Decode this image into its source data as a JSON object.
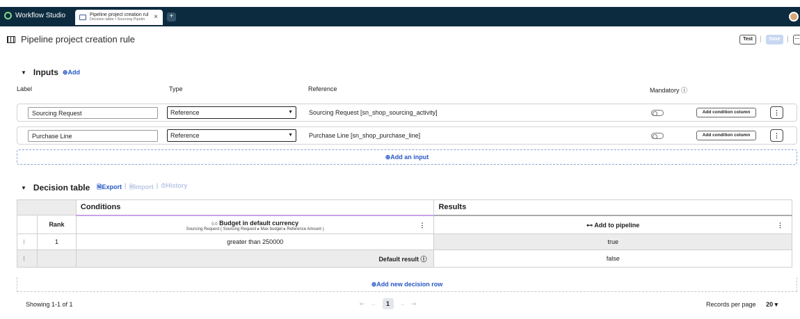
{
  "app": {
    "brand": "Workflow Studio"
  },
  "tab": {
    "title": "Pipeline project creation rul",
    "subtitle": "Decision table • Sourcing Pipelin",
    "close": "×",
    "add": "+"
  },
  "header": {
    "title": "Pipeline project creation rule",
    "test": "Test",
    "save": "Save",
    "more": "···",
    "sep": "|"
  },
  "inputs": {
    "title": "Inputs",
    "add": "⊕Add",
    "columns": {
      "label": "Label",
      "type": "Type",
      "reference": "Reference",
      "mandatory": "Mandatory ⓘ"
    },
    "rows": [
      {
        "label": "Sourcing Request",
        "type": "Reference",
        "reference": "Sourcing Request [sn_shop_sourcing_activity]",
        "action": "Add condition column"
      },
      {
        "label": "Purchase Line",
        "type": "Reference",
        "reference": "Purchase Line [sn_shop_purchase_line]",
        "action": "Add condition column"
      }
    ],
    "add_input": "⊕Add an input"
  },
  "decision": {
    "title": "Decision table",
    "export": "🗎Export",
    "import": "🗎Import",
    "history": "⏱History",
    "sep": "|",
    "conditions": "Conditions",
    "results": "Results",
    "rank": "Rank",
    "budget_prefix": "0.0",
    "budget_title": "Budget in default currency",
    "budget_sub": "Sourcing Request ( Sourcing Request ▸ Max budget ▸ Reference Amount )",
    "pipeline": "⊷ Add to pipeline",
    "row_rank": "1",
    "row_condition": "greater than 250000",
    "row_result": "true",
    "default_label": "Default result ⓘ",
    "default_value": "false",
    "add_row": "⊕Add new decision row"
  },
  "footer": {
    "showing": "Showing 1-1 of 1",
    "page": "1",
    "records_label": "Records per page",
    "records_value": "20 ▾"
  }
}
